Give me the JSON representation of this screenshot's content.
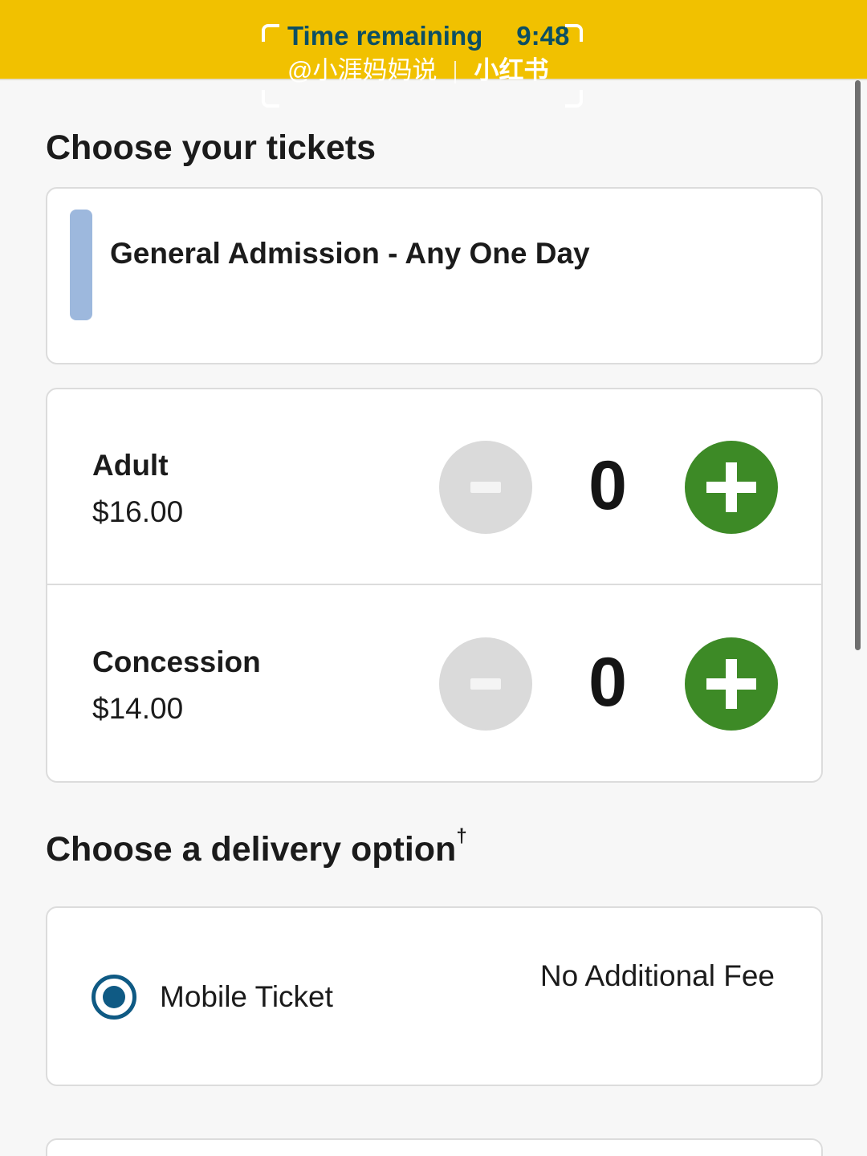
{
  "timer": {
    "label": "Time remaining",
    "value": "9:48"
  },
  "watermark": {
    "handle": "@小涯妈妈说",
    "brand": "小红书"
  },
  "tickets_section": {
    "title": "Choose your tickets",
    "ticket_type": {
      "name": "General Admission - Any One Day",
      "accent_color": "#9db8dd"
    },
    "items": [
      {
        "name": "Adult",
        "price": "$16.00",
        "quantity": "0"
      },
      {
        "name": "Concession",
        "price": "$14.00",
        "quantity": "0"
      }
    ]
  },
  "delivery_section": {
    "title": "Choose a delivery option",
    "title_marker": "†",
    "options": [
      {
        "label": "Mobile Ticket",
        "fee": "No Additional Fee",
        "selected": true
      }
    ]
  },
  "colors": {
    "header_bg": "#f1c100",
    "timer_text": "#0c4f63",
    "plus_button": "#3d8a26",
    "minus_button_disabled": "#dadada",
    "radio_selected": "#0f5a84"
  },
  "icons": {
    "decrement": "minus-icon",
    "increment": "plus-icon",
    "radio": "radio-selected-icon"
  }
}
